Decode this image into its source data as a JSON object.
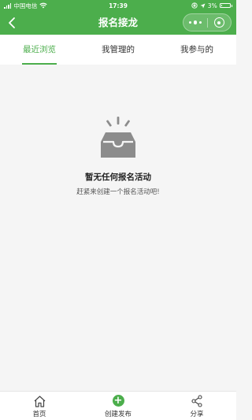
{
  "status_bar": {
    "carrier": "中国电信",
    "time": "17:39",
    "battery_percent": "3%"
  },
  "nav": {
    "title": "报名接龙"
  },
  "tabs": [
    {
      "label": "最近浏览",
      "active": true
    },
    {
      "label": "我管理的",
      "active": false
    },
    {
      "label": "我参与的",
      "active": false
    }
  ],
  "empty_state": {
    "title": "暂无任何报名活动",
    "subtitle": "赶紧来创建一个报名活动吧!"
  },
  "bottom_bar": {
    "items": [
      {
        "label": "首页",
        "icon": "home-icon"
      },
      {
        "label": "创建发布",
        "icon": "plus-circle-icon"
      },
      {
        "label": "分享",
        "icon": "share-icon"
      }
    ]
  },
  "colors": {
    "brand": "#4cae4c",
    "icon_gray": "#8c8c8c"
  }
}
